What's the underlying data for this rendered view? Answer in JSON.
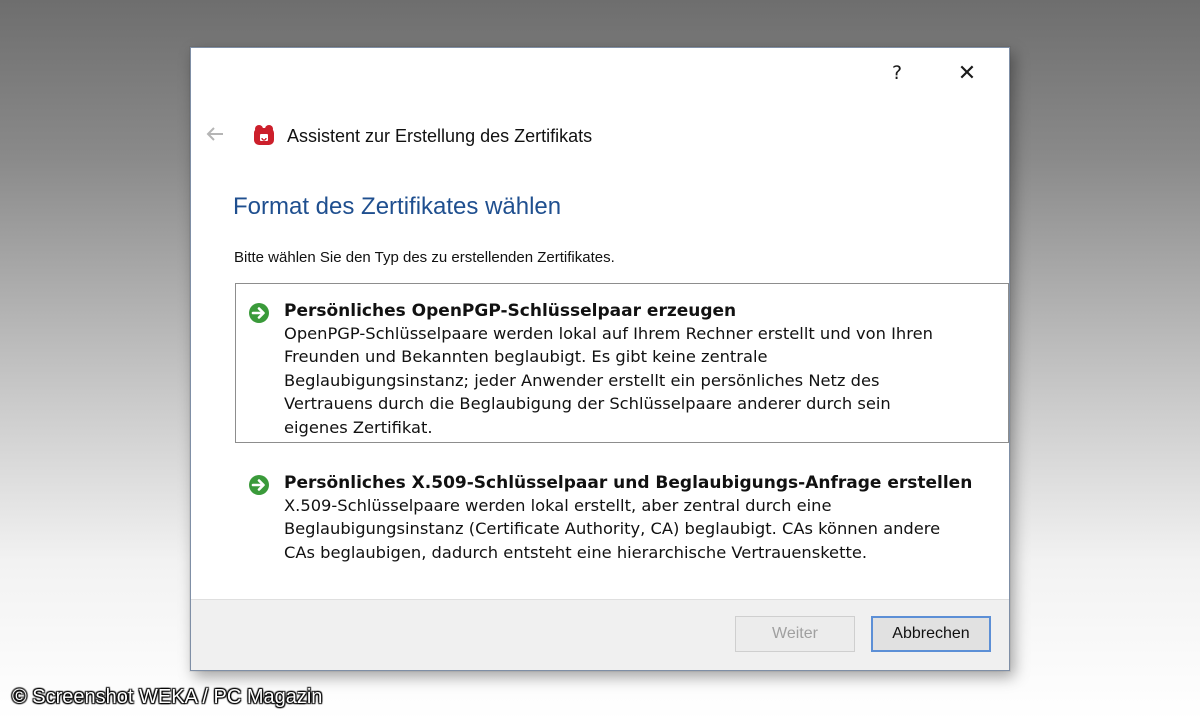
{
  "titlebar": {
    "help_label": "?",
    "close_label": "✕"
  },
  "wizard": {
    "title": "Assistent zur Erstellung des Zertifikats"
  },
  "page": {
    "title": "Format des Zertifikates wählen",
    "instruction": "Bitte wählen Sie den Typ des zu erstellenden Zertifikates."
  },
  "options": [
    {
      "title": "Persönliches OpenPGP-Schlüsselpaar erzeugen",
      "description_lines": [
        "OpenPGP-Schlüsselpaare werden lokal auf Ihrem Rechner erstellt und von Ihren",
        "Freunden und Bekannten beglaubigt. Es gibt keine zentrale",
        "Beglaubigungsinstanz; jeder Anwender erstellt ein persönliches Netz des",
        "Vertrauens durch die Beglaubigung der Schlüsselpaare anderer durch sein",
        "eigenes Zertifikat."
      ]
    },
    {
      "title": "Persönliches X.509-Schlüsselpaar und Beglaubigungs-Anfrage erstellen",
      "description_lines": [
        "X.509-Schlüsselpaare werden lokal erstellt, aber zentral durch eine",
        "Beglaubigungsinstanz (Certificate Authority, CA) beglaubigt. CAs können andere",
        "CAs beglaubigen, dadurch entsteht eine hierarchische Vertrauenskette."
      ]
    }
  ],
  "buttons": {
    "next_label": "Weiter",
    "cancel_label": "Abbrechen"
  },
  "watermark": "© Screenshot WEKA / PC Magazin",
  "colors": {
    "accent": "#1f4f8f",
    "option_arrow": "#3a9a3a"
  }
}
